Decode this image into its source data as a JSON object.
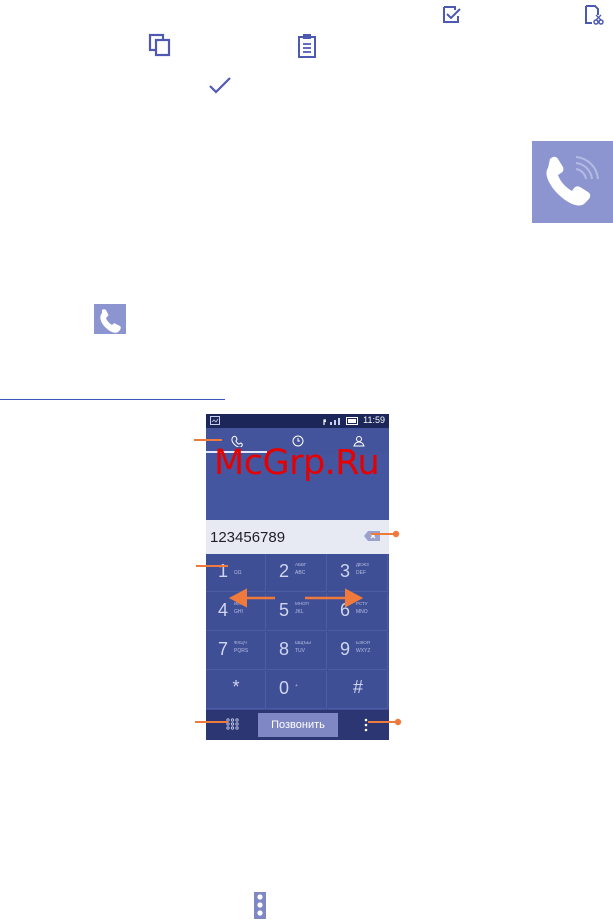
{
  "phone": {
    "status_time": "11:59",
    "number": "123456789",
    "keys": [
      {
        "digit": "1",
        "top": "",
        "bottom": "ΩΩ"
      },
      {
        "digit": "2",
        "top": "АБВГ",
        "bottom": "ABC"
      },
      {
        "digit": "3",
        "top": "ДЕЖЗ",
        "bottom": "DEF"
      },
      {
        "digit": "4",
        "top": "ИЙКЛ",
        "bottom": "GHI"
      },
      {
        "digit": "5",
        "top": "МНОП",
        "bottom": "JKL"
      },
      {
        "digit": "6",
        "top": "РСТУ",
        "bottom": "MNO"
      },
      {
        "digit": "7",
        "top": "ФХЦЧ",
        "bottom": "PQRS"
      },
      {
        "digit": "8",
        "top": "ШЩЪЫ",
        "bottom": "TUV"
      },
      {
        "digit": "9",
        "top": "ЬЭЮЯ",
        "bottom": "WXYZ"
      },
      {
        "digit": "*",
        "top": "",
        "bottom": ""
      },
      {
        "digit": "0",
        "top": "",
        "bottom": "+"
      },
      {
        "digit": "#",
        "top": "",
        "bottom": ""
      }
    ],
    "call_label": "Позвонить"
  },
  "watermark": "McGrp.Ru",
  "colors": {
    "phone_bg": "#3f4f95",
    "status_bar": "#1c2658",
    "icon_tile": "#8c95d0",
    "callout_orange": "#f07a3c",
    "link_rule": "#3d57b8"
  }
}
